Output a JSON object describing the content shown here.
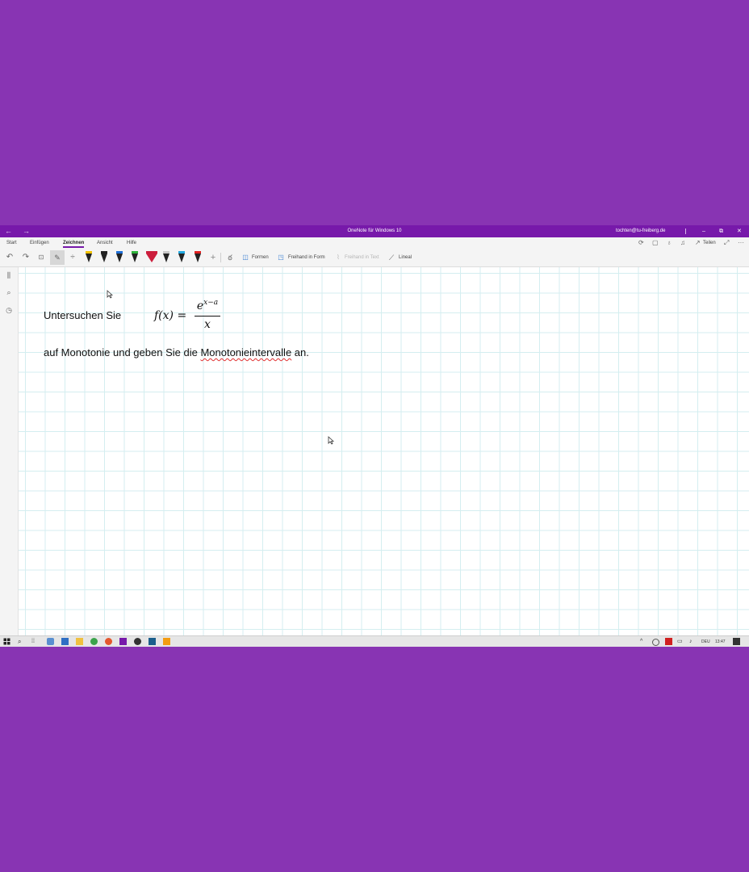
{
  "window": {
    "title": "OneNote für Windows 10",
    "account": "tochten@tu-freiberg.de",
    "back_glyph": "←",
    "forward_glyph": "→",
    "minimize_glyph": "–",
    "restore_glyph": "⧉",
    "close_glyph": "✕",
    "titlebar_color": "#7719aa",
    "background_color": "#8834b3"
  },
  "tabs": [
    {
      "label": "Start"
    },
    {
      "label": "Einfügen"
    },
    {
      "label": "Zeichnen"
    },
    {
      "label": "Ansicht"
    },
    {
      "label": "Hilfe"
    }
  ],
  "active_tab": "Zeichnen",
  "tab_actions": {
    "share_label": "Teilen",
    "more_glyph": "···"
  },
  "toolbar": {
    "undo_glyph": "↶",
    "redo_glyph": "↷",
    "add_pen_glyph": "+",
    "shapes_label": "Formen",
    "ink_to_shape_label": "Freihand in Form",
    "ink_to_text_label": "Freihand in Text",
    "ruler_label": "Lineal",
    "pens": [
      {
        "color": "#222222",
        "nib": "#f2c200"
      },
      {
        "color": "#222222",
        "nib": "#222222"
      },
      {
        "color": "#222222",
        "nib": "#1e6fd8"
      },
      {
        "color": "#222222",
        "nib": "#2db33a"
      },
      {
        "color": "#cc1e3c",
        "nib": "#cc1e3c"
      },
      {
        "color": "#222222",
        "nib": "#c8c8c8"
      },
      {
        "color": "#222222",
        "nib": "#21a8e0"
      },
      {
        "color": "#222222",
        "nib": "#e02020"
      }
    ]
  },
  "page": {
    "line1": "Untersuchen Sie",
    "formula": {
      "lhs": "f(x) =",
      "numerator_base": "e",
      "numerator_exp": "x−a",
      "denominator": "x"
    },
    "line2_before": "auf Monotonie und geben Sie die ",
    "line2_misspelled": "Monotonieintervalle",
    "line2_after": " an."
  },
  "taskbar": {
    "language": "DEU",
    "time": "13:47"
  }
}
